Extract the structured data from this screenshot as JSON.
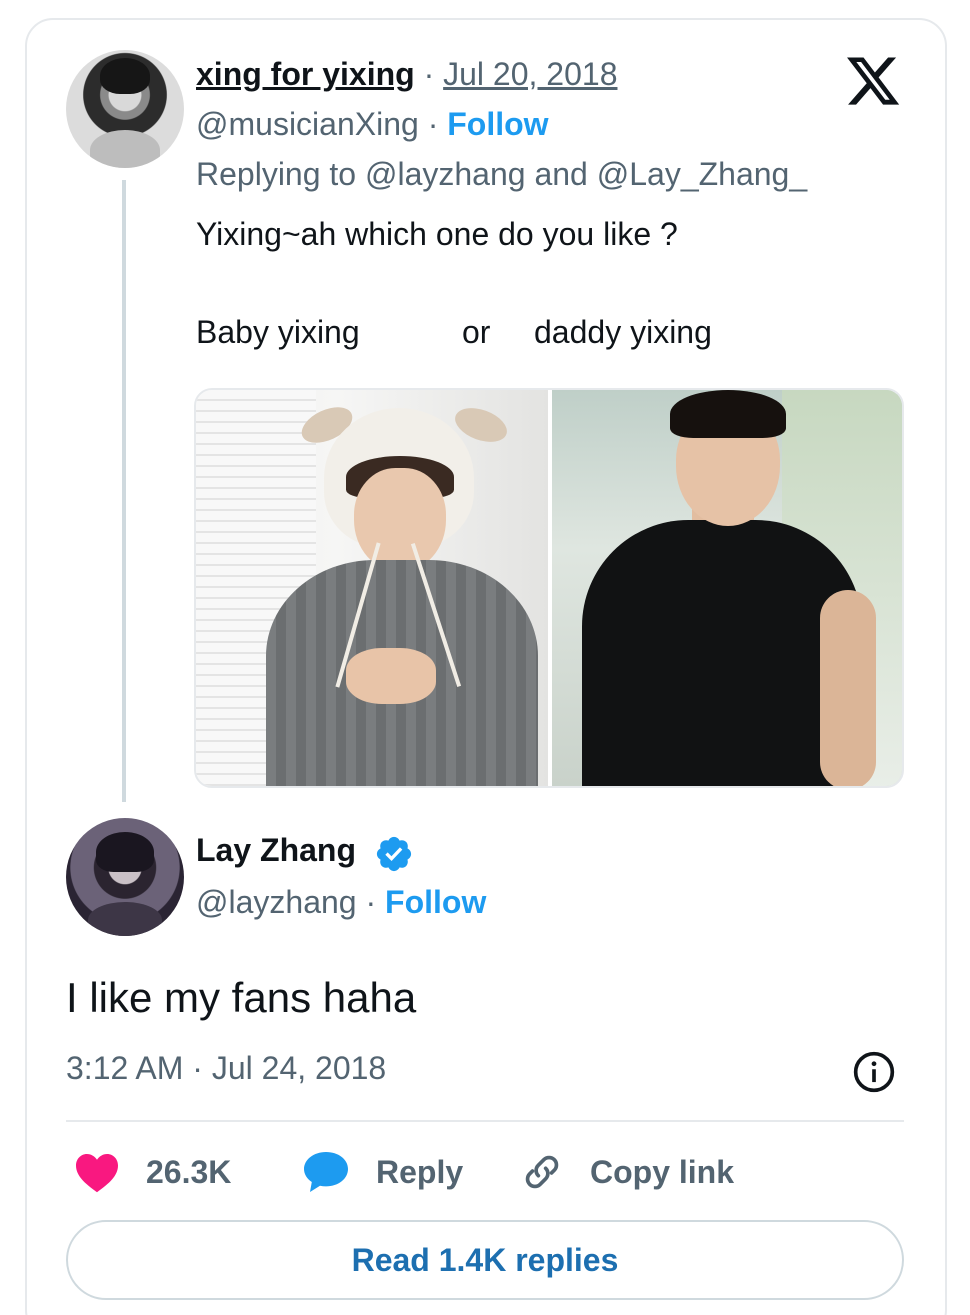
{
  "parent_tweet": {
    "display_name": "xing for yixing",
    "separator": "·",
    "date": "Jul 20, 2018",
    "handle": "@musicianXing",
    "follow_label": "Follow",
    "replying_to": "Replying to @layzhang and @Lay_Zhang_",
    "text": "Yixing~ah which one do you like ?",
    "choice_left": "Baby yixing",
    "choice_mid": "or",
    "choice_right": "daddy yixing"
  },
  "main_tweet": {
    "display_name": "Lay Zhang",
    "handle": "@layzhang",
    "separator": "·",
    "follow_label": "Follow",
    "text": "I like my fans haha",
    "timestamp": "3:12 AM · Jul 24, 2018"
  },
  "actions": {
    "like_count": "26.3K",
    "reply_label": "Reply",
    "copy_link_label": "Copy link"
  },
  "read_replies_label": "Read 1.4K replies",
  "icons": {
    "brand": "x-logo-icon",
    "verified": "verified-badge-icon",
    "info": "info-icon",
    "like": "heart-icon",
    "reply": "speech-bubble-icon",
    "copy_link": "link-icon"
  },
  "colors": {
    "link_blue": "#1d9bf0",
    "read_replies_blue": "#1d6fb0",
    "like_pink": "#f91880",
    "muted_text": "#536471",
    "primary_text": "#0f1419",
    "border": "#e6e9ec"
  }
}
